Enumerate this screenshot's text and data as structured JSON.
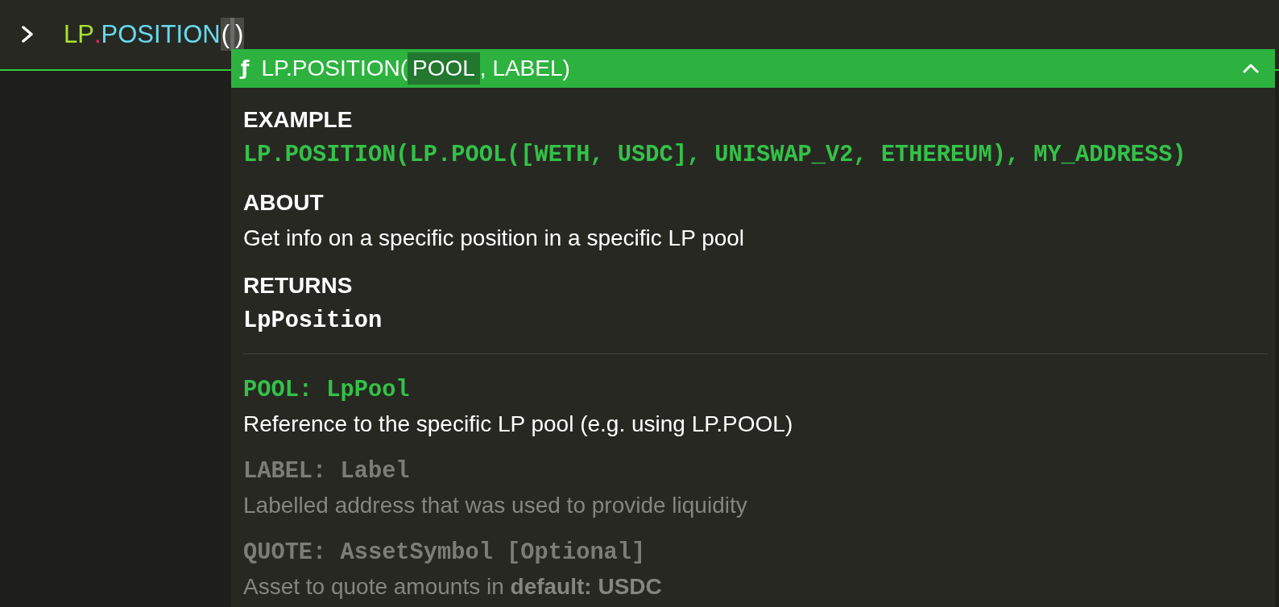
{
  "command_line": {
    "tokens": [
      {
        "text": "LP",
        "kind": "namespace",
        "matched": false
      },
      {
        "text": ".",
        "kind": "dot",
        "matched": false
      },
      {
        "text": "POSITION",
        "kind": "function",
        "matched": false
      },
      {
        "text": "(",
        "kind": "paren",
        "matched": true
      },
      {
        "kind": "cursor"
      },
      {
        "text": ")",
        "kind": "paren",
        "matched": true
      }
    ]
  },
  "signature_help": {
    "expanded": true,
    "icon": "ƒ",
    "signature": [
      {
        "text": "LP.POSITION(",
        "kind": "text"
      },
      {
        "text": "POOL",
        "kind": "param",
        "selected": true
      },
      {
        "text": ", ",
        "kind": "text"
      },
      {
        "text": "LABEL",
        "kind": "param",
        "selected": false
      },
      {
        "text": ")",
        "kind": "text"
      }
    ],
    "sections": [
      {
        "heading": "EXAMPLE",
        "kind": "code",
        "text": "LP.POSITION(LP.POOL([WETH, USDC], UNISWAP_V2, ETHEREUM), MY_ADDRESS)"
      },
      {
        "heading": "ABOUT",
        "kind": "prose",
        "text": "Get info on a specific position in a specific LP pool"
      },
      {
        "heading": "RETURNS",
        "kind": "type",
        "text": "LpPosition"
      }
    ],
    "parameters": [
      {
        "signature": "POOL: LpPool",
        "description": "Reference to the specific LP pool (e.g. using LP.POOL)",
        "selected": true
      },
      {
        "signature": "LABEL: Label",
        "description": "Labelled address that was used to provide liquidity",
        "selected": false
      },
      {
        "signature": "QUOTE: AssetSymbol [Optional]",
        "description": "Asset to quote amounts in **default: USDC**",
        "selected": false
      }
    ]
  }
}
